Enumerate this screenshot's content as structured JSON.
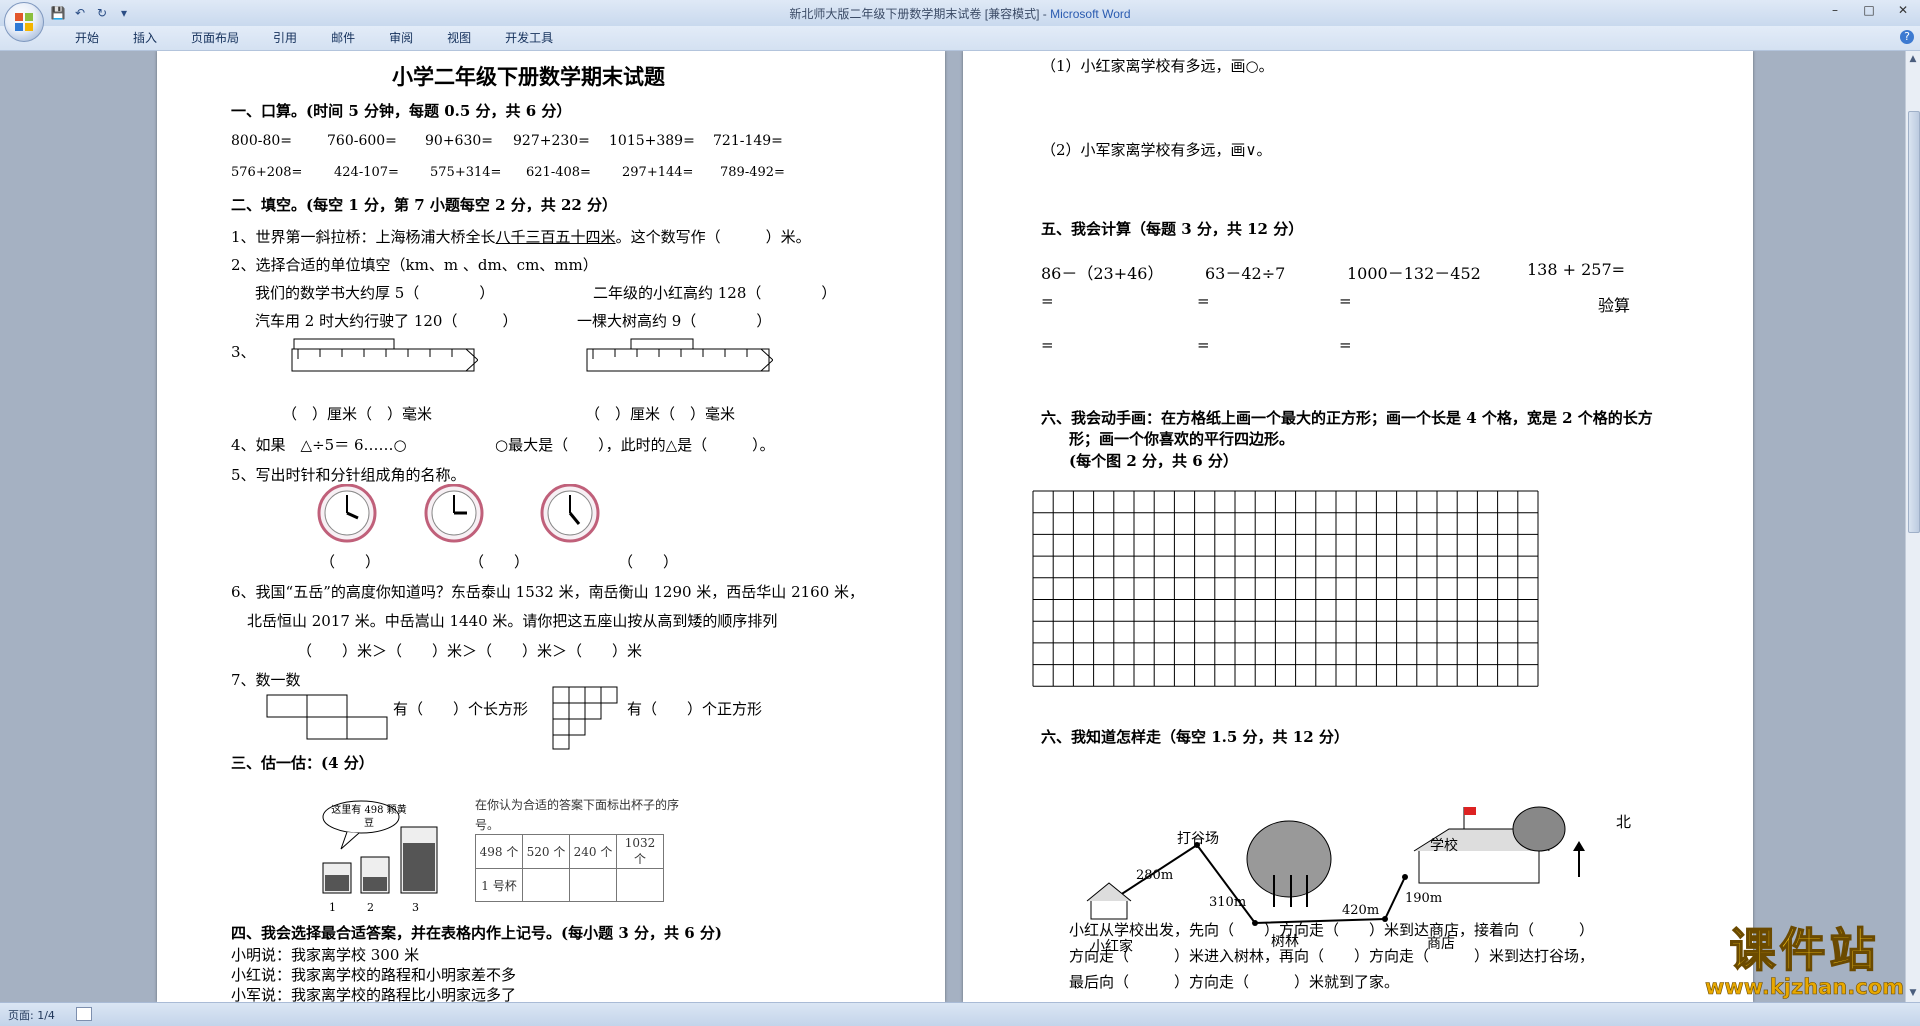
{
  "window": {
    "title": "新北师大版二年级下册数学期末试卷 [兼容模式] - ",
    "app_name": "Microsoft Word",
    "minimize": "–",
    "maximize": "□",
    "close": "✕"
  },
  "quick_access": {
    "save": "💾",
    "undo": "↶",
    "redo": "↻",
    "customize": "▾"
  },
  "ribbon_tabs": [
    "开始",
    "插入",
    "页面布局",
    "引用",
    "邮件",
    "审阅",
    "视图",
    "开发工具"
  ],
  "status": {
    "page": "页面: 1/4"
  },
  "watermark": {
    "line1": "课件站",
    "line2": "www.kjzhan.com"
  },
  "page1": {
    "title": "小学二年级下册数学期末试题",
    "s1_heading": "一、口算。(时间 5 分钟，每题 0.5 分，共 6 分）",
    "oral_row1": [
      "800-80=",
      "760-600=",
      "90+630=",
      "927+230=",
      "1015+389=",
      "721-149="
    ],
    "oral_row2": [
      "576+208=",
      "424-107=",
      "575+314=",
      "621-408=",
      "297+144=",
      "789-492="
    ],
    "s2_heading": "二、填空。(每空 1 分，第 7 小题每空 2 分，共 22 分）",
    "q1_a": "1、世界第一斜拉桥：上海杨浦大桥全长",
    "q1_u": "八千三百五十四米",
    "q1_b": "。这个数写作（　　　）米。",
    "q2": "2、选择合适的单位填空（km、m 、dm、cm、mm）",
    "q2_l1a": "我们的数学书大约厚 5（　　　　）",
    "q2_l1b": "二年级的小红高约 128（　　　　）",
    "q2_l2a": "汽车用 2 时大约行驶了 120（　　　）",
    "q2_l2b": "一棵大树高约 9（　　　　）",
    "q3": "3、",
    "q3_ans_a": "（　）厘米（　）毫米",
    "q3_ans_b": "（　）厘米（　）毫米",
    "q4_a": "4、如果　△÷5＝ 6……○",
    "q4_b": "○最大是（　　），此时的△是（　　　）。",
    "q5": "5、写出时针和分针组成角的名称。",
    "q5_blank": "（　　）",
    "q6_l1": "6、我国“五岳”的高度你知道吗？东岳泰山 1532 米，南岳衡山 1290 米，西岳华山 2160 米，",
    "q6_l2": "北岳恒山 2017 米。中岳嵩山 1440 米。请你把这五座山按从高到矮的顺序排列",
    "q6_l3": "（　　）米＞（　　）米＞（　　）米＞（　　）米",
    "q7": "7、数一数",
    "q7_a": "有（　　）个长方形",
    "q7_b": "有（　　）个正方形",
    "s3_heading": "三、估一估：(4 分）",
    "s3_bubble": "这里有 498 颗黄豆",
    "s3_desc": "在你认为合适的答案下面标出杯子的序号。",
    "s3_table_head": [
      "498 个",
      "520 个",
      "240 个",
      "1032 个"
    ],
    "s3_table_row": "1 号杯",
    "s3_cups": [
      "1",
      "2",
      "3"
    ],
    "s4_heading": "四、我会选择最合适答案，并在表格内作上记号。(每小题 3 分，共 6 分)",
    "s4_l1": "小明说：我家离学校 300 米",
    "s4_l2": "小红说：我家离学校的路程和小明家差不多",
    "s4_l3": "小军说：我家离学校的路程比小明家远多了"
  },
  "page2": {
    "p1": "（1）小红家离学校有多远，画○。",
    "p2": "（2）小军家离学校有多远，画∨。",
    "s5_heading": "五、我会计算（每题 3 分，共 12 分）",
    "calc": [
      "86－（23+46）",
      "63－42÷7",
      "1000－132－452",
      "138 + 257="
    ],
    "eq": "=",
    "check": "验算",
    "s6_heading_l1": "六、我会动手画：在方格纸上画一个最大的正方形；画一个长是 4 个格，宽是 2 个格的长方",
    "s6_heading_l2": "形；画一个你喜欢的平行四边形。",
    "s6_heading_l3": "(每个图 2 分，共 6 分）",
    "s7_heading": "六、我知道怎样走（每空 1.5 分，共 12 分）",
    "map_labels": {
      "daguchang": "打谷场",
      "xiaohongjia": "小红家",
      "shulin": "树林",
      "shangdian": "商店",
      "xuexiao": "学校",
      "bei": "北",
      "d1": "280m",
      "d2": "310m",
      "d3": "420m",
      "d4": "190m"
    },
    "route_l1": "小红从学校出发，先向（　　）方向走（　　）米到达商店，接着向（　　　）",
    "route_l2": "方向走（　　　）米进入树林，再向（　　）方向走（　　　）米到达打谷场，",
    "route_l3": "最后向（　　　）方向走（　　　）米就到了家。"
  }
}
